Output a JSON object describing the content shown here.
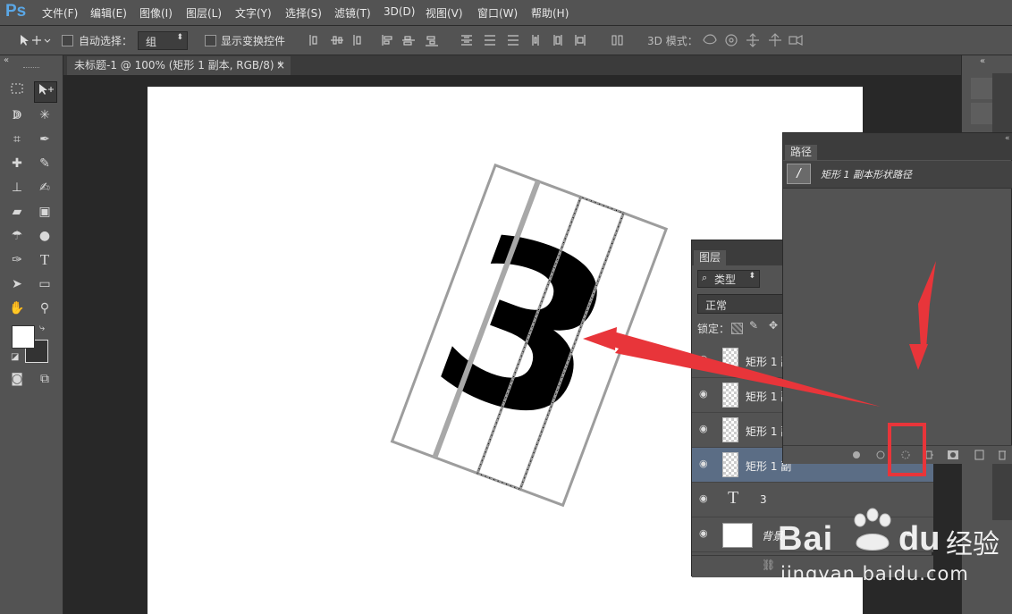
{
  "app": {
    "logo": "Ps"
  },
  "menu": [
    "文件(F)",
    "编辑(E)",
    "图像(I)",
    "图层(L)",
    "文字(Y)",
    "选择(S)",
    "滤镜(T)",
    "3D(D)",
    "视图(V)",
    "窗口(W)",
    "帮助(H)"
  ],
  "options": {
    "auto_select_label": "自动选择：",
    "auto_select_value": "组",
    "show_transform_label": "显示变换控件",
    "mode_3d_label": "3D 模式："
  },
  "document": {
    "tab_title": "未标题-1 @ 100% (矩形 1 副本, RGB/8) *",
    "close": "×",
    "glyph": "3"
  },
  "paths_panel": {
    "tab": "路径",
    "items": [
      {
        "name": "矩形 1 副本形状路径",
        "thumb": "/"
      }
    ]
  },
  "layers_panel": {
    "tab": "图层",
    "filter_label": "类型",
    "blend_mode": "正常",
    "lock_label": "锁定：",
    "layers": [
      {
        "name": "矩形 1 副",
        "type": "shape"
      },
      {
        "name": "矩形 1 副",
        "type": "shape"
      },
      {
        "name": "矩形 1 副",
        "type": "shape"
      },
      {
        "name": "矩形 1 副",
        "type": "shape",
        "selected": true
      },
      {
        "name": "3",
        "type": "text"
      },
      {
        "name": "背景",
        "type": "background"
      }
    ]
  },
  "watermark": {
    "brand": "Bai",
    "brand2": "du",
    "cn": "经验",
    "url": "jingyan.baidu.com"
  },
  "colors": {
    "annotation": "#e8353a",
    "ui_panel": "#535353",
    "ps_blue": "#5aa7e6"
  }
}
